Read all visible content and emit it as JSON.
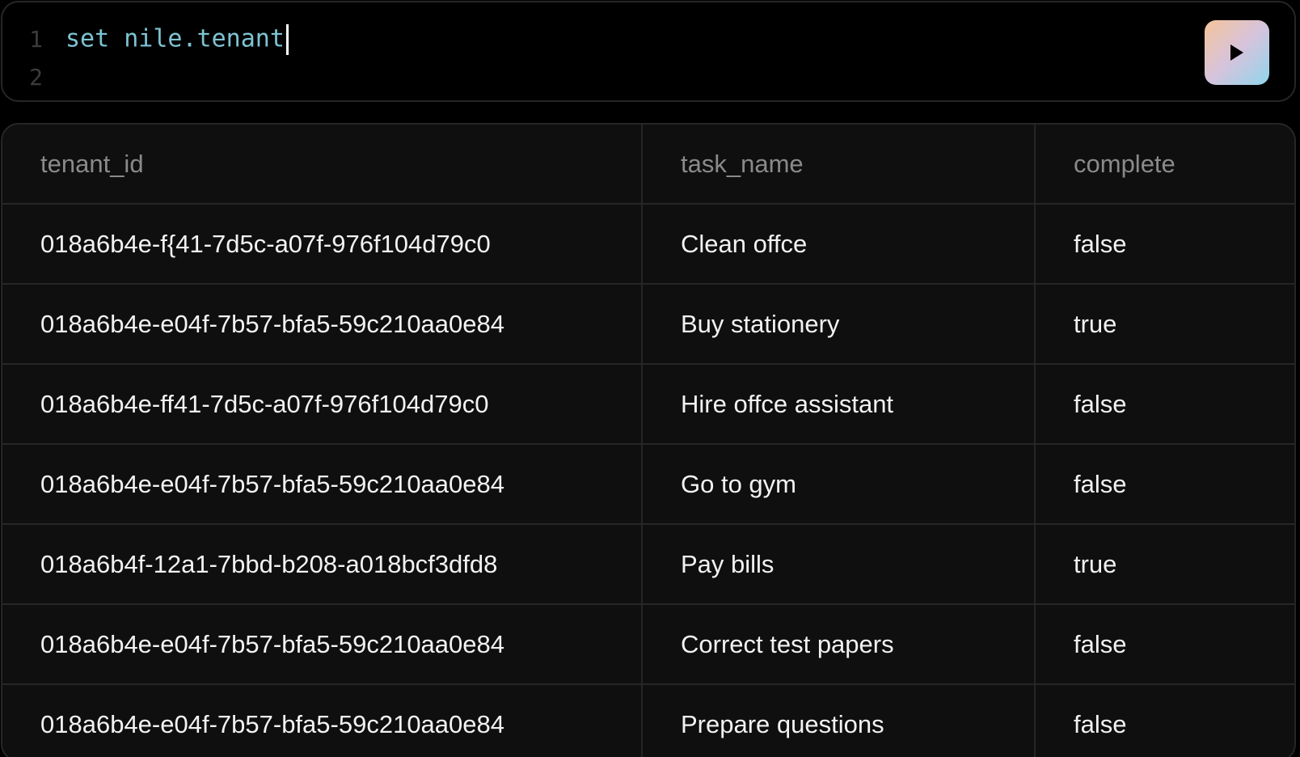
{
  "editor": {
    "lines": [
      {
        "number": "1",
        "code": "set nile.tenant"
      },
      {
        "number": "2",
        "code": ""
      }
    ],
    "run_button_icon": "play-icon",
    "code_color": "#7ec3d3"
  },
  "results": {
    "columns": [
      "tenant_id",
      "task_name",
      "complete"
    ],
    "rows": [
      [
        "018a6b4e-f{41-7d5c-a07f-976f104d79c0",
        "Clean offce",
        "false"
      ],
      [
        "018a6b4e-e04f-7b57-bfa5-59c210aa0e84",
        "Buy stationery",
        "true"
      ],
      [
        "018a6b4e-ff41-7d5c-a07f-976f104d79c0",
        "Hire offce assistant",
        "false"
      ],
      [
        "018a6b4e-e04f-7b57-bfa5-59c210aa0e84",
        "Go to gym",
        "false"
      ],
      [
        "018a6b4f-12a1-7bbd-b208-a018bcf3dfd8",
        "Pay bills",
        "true"
      ],
      [
        "018a6b4e-e04f-7b57-bfa5-59c210aa0e84",
        "Correct test papers",
        "false"
      ],
      [
        "018a6b4e-e04f-7b57-bfa5-59c210aa0e84",
        "Prepare questions",
        "false"
      ]
    ]
  }
}
